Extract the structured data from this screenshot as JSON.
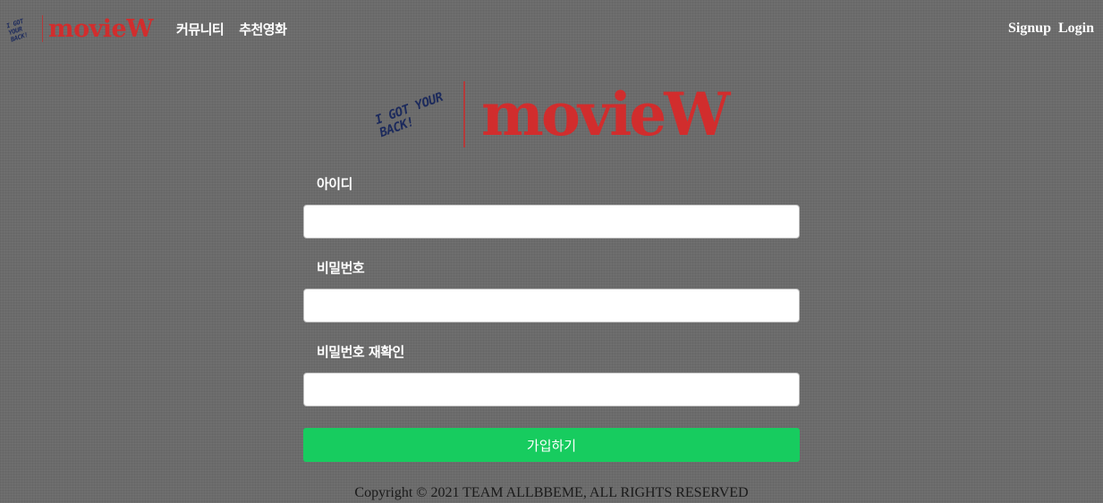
{
  "header": {
    "logo_tagline": "I GOT YOUR BACK!",
    "logo_brand": "movieW",
    "nav": [
      "커뮤니티",
      "추천영화"
    ],
    "signup": "Signup",
    "login": "Login"
  },
  "hero": {
    "tagline": "I GOT YOUR BACK!",
    "brand": "movieW"
  },
  "form": {
    "id_label": "아이디",
    "id_value": "",
    "password_label": "비밀번호",
    "password_value": "",
    "confirm_label": "비밀번호 재확인",
    "confirm_value": "",
    "submit": "가입하기"
  },
  "footer": {
    "copyright": "Copyright © 2021 TEAM ALLBBEME, ALL RIGHTS RESERVED"
  },
  "colors": {
    "background": "#6b6b6b",
    "brand_red": "#d12d2d",
    "submit_green": "#17cc5f",
    "script_navy": "#1c2a5c"
  }
}
